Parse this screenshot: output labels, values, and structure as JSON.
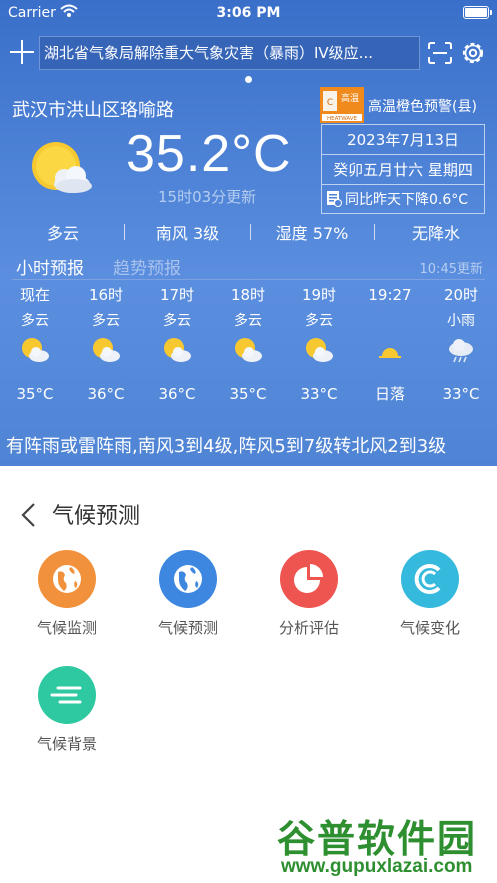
{
  "status": {
    "carrier": "Carrier",
    "time": "3:06 PM"
  },
  "alert": {
    "text": "湖北省气象局解除重大气象灾害（暴雨）IV级应..."
  },
  "location": "武汉市洪山区珞喻路",
  "current": {
    "temp": "35.2°C",
    "update": "15时03分更新",
    "icon": "cloud-sun-icon"
  },
  "warning": {
    "label": "高温橙色预警(县)",
    "icon_text": "高温",
    "icon_sub": "HEATWAVE",
    "color": "#f08a1c"
  },
  "info": {
    "date": "2023年7月13日",
    "lunar": "癸卯五月廿六 星期四",
    "compare": "同比昨天下降0.6°C"
  },
  "summary": {
    "condition": "多云",
    "wind": "南风 3级",
    "humidity": "湿度 57%",
    "rain": "无降水"
  },
  "tabs": {
    "hourly": "小时预报",
    "trend": "趋势预报",
    "update": "10:45更新"
  },
  "hours": [
    {
      "label": "现在",
      "cond": "多云",
      "temp": "35°C",
      "icon": "cloud-sun-icon"
    },
    {
      "label": "16时",
      "cond": "多云",
      "temp": "36°C",
      "icon": "cloud-sun-icon"
    },
    {
      "label": "17时",
      "cond": "多云",
      "temp": "36°C",
      "icon": "cloud-sun-icon"
    },
    {
      "label": "18时",
      "cond": "多云",
      "temp": "35°C",
      "icon": "cloud-sun-icon"
    },
    {
      "label": "19时",
      "cond": "多云",
      "temp": "33°C",
      "icon": "cloud-sun-icon"
    },
    {
      "label": "19:27",
      "cond": "",
      "temp": "日落",
      "icon": "sunset-icon"
    },
    {
      "label": "20时",
      "cond": "小雨",
      "temp": "33°C",
      "icon": "light-rain-icon"
    }
  ],
  "ticker": "有阵雨或雷阵雨,南风3到4级,阵风5到7级转北风2到3级",
  "panel": {
    "title": "气候预测",
    "tiles": [
      {
        "label": "气候监测",
        "color": "#f2913c",
        "icon": "globe-icon"
      },
      {
        "label": "气候预测",
        "color": "#3d87e0",
        "icon": "globe-icon"
      },
      {
        "label": "分析评估",
        "color": "#ef5550",
        "icon": "pie-chart-icon"
      },
      {
        "label": "气候变化",
        "color": "#35b9dd",
        "icon": "climate-change-icon"
      },
      {
        "label": "气候背景",
        "color": "#2ec9a1",
        "icon": "wind-lines-icon"
      }
    ]
  },
  "watermark": {
    "main": "谷普软件园",
    "url": "www.gupuxlazai.com"
  }
}
